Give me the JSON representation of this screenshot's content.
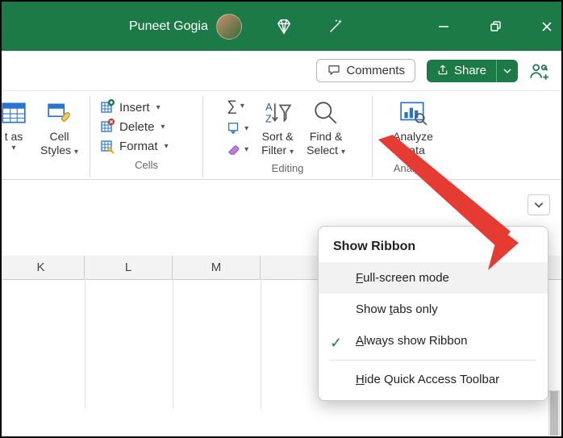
{
  "titlebar": {
    "username": "Puneet Gogia"
  },
  "secondbar": {
    "comments": "Comments",
    "share": "Share"
  },
  "ribbon": {
    "format_as": {
      "line1": "t as"
    },
    "cell_styles": {
      "line1": "Cell",
      "line2": "Styles"
    },
    "cells": {
      "insert": "Insert",
      "delete": "Delete",
      "format": "Format",
      "group": "Cells"
    },
    "editing": {
      "sort_filter": {
        "line1": "Sort &",
        "line2": "Filter"
      },
      "find_select": {
        "line1": "Find &",
        "line2": "Select"
      },
      "group": "Editing"
    },
    "analysis": {
      "analyze_data": {
        "line1": "Analyze",
        "line2": "Data"
      },
      "group": "Analysis"
    }
  },
  "columns": [
    "K",
    "L",
    "M"
  ],
  "popup": {
    "title": "Show Ribbon",
    "full_screen": "Full-screen mode",
    "tabs_only": "Show tabs only",
    "always_show_pre": "",
    "always_show": "Always show Ribbon",
    "hide_qat": "Hide Quick Access Toolbar"
  }
}
